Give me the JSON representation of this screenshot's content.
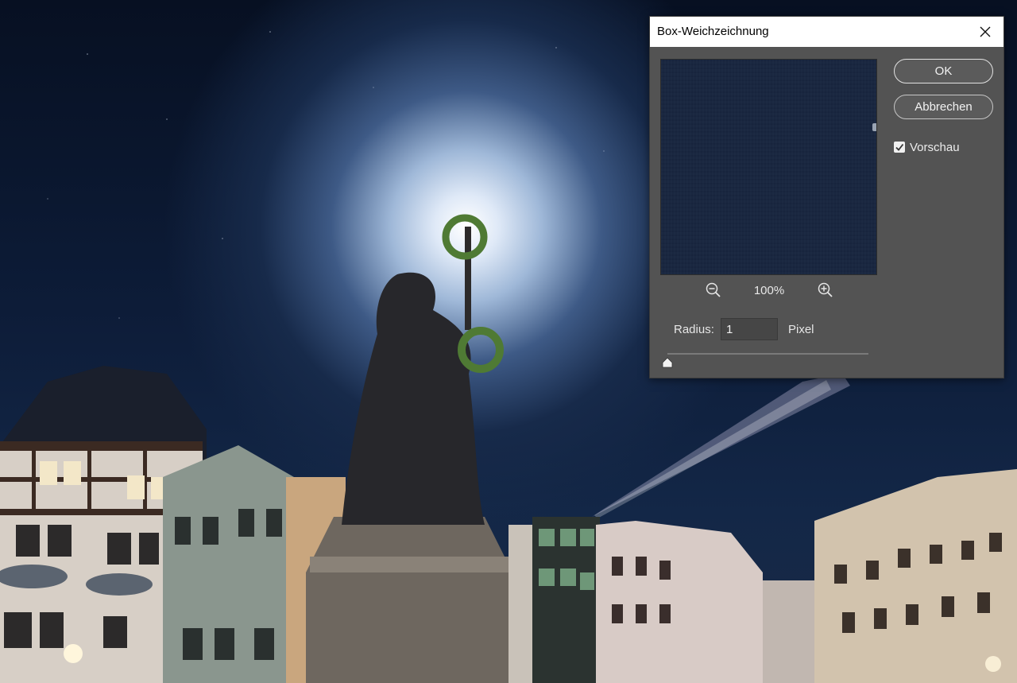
{
  "dialog": {
    "title": "Box-Weichzeichnung",
    "ok_label": "OK",
    "cancel_label": "Abbrechen",
    "preview_checkbox_label": "Vorschau",
    "preview_checked": true,
    "zoom_level": "100%",
    "radius_label": "Radius:",
    "radius_value": "1",
    "radius_unit": "Pixel",
    "icons": {
      "close": "close-icon",
      "zoom_out": "zoom-out-icon",
      "zoom_in": "zoom-in-icon",
      "checkbox": "checkmark-icon"
    }
  },
  "colors": {
    "dialog_bg": "#535353",
    "titlebar_bg": "#ffffff",
    "preview_bg": "#17253f",
    "night_sky": "#0d1c38"
  }
}
